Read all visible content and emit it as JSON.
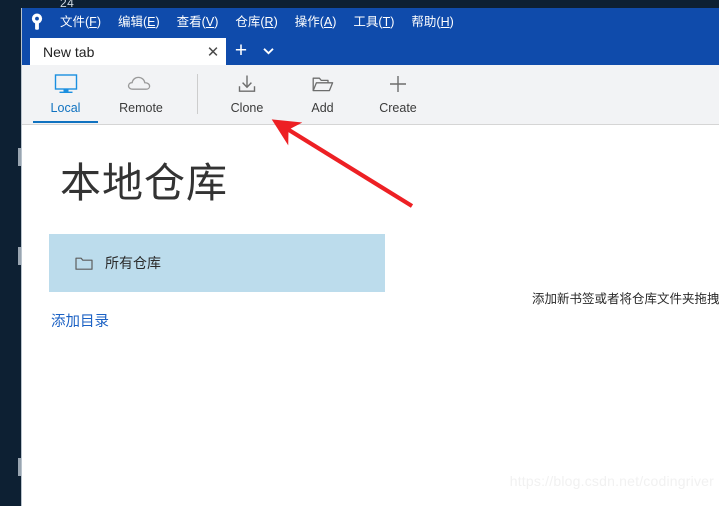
{
  "desktop": {
    "clipped_label": "24"
  },
  "titlebar": {
    "logo_icon": "sourcetree-key-icon",
    "menu": [
      {
        "label": "文件(F)",
        "text": "文件(",
        "mnemonic": "F",
        "tail": ")"
      },
      {
        "label": "编辑(E)",
        "text": "编辑(",
        "mnemonic": "E",
        "tail": ")"
      },
      {
        "label": "查看(V)",
        "text": "查看(",
        "mnemonic": "V",
        "tail": ")"
      },
      {
        "label": "仓库(R)",
        "text": "仓库(",
        "mnemonic": "R",
        "tail": ")"
      },
      {
        "label": "操作(A)",
        "text": "操作(",
        "mnemonic": "A",
        "tail": ")"
      },
      {
        "label": "工具(T)",
        "text": "工具(",
        "mnemonic": "T",
        "tail": ")"
      },
      {
        "label": "帮助(H)",
        "text": "帮助(",
        "mnemonic": "H",
        "tail": ")"
      }
    ]
  },
  "tabstrip": {
    "tab_title": "New tab",
    "close_glyph": "✕",
    "new_tab_glyph": "+",
    "dropdown_icon": "chevron-down-icon"
  },
  "toolbar": {
    "buttons": [
      {
        "label": "Local",
        "icon": "monitor-icon",
        "active": true
      },
      {
        "label": "Remote",
        "icon": "cloud-icon",
        "active": false
      },
      {
        "label": "Clone",
        "icon": "download-tray-icon",
        "active": false
      },
      {
        "label": "Add",
        "icon": "open-folder-icon",
        "active": false
      },
      {
        "label": "Create",
        "icon": "plus-icon",
        "active": false
      }
    ]
  },
  "content": {
    "page_title": "本地仓库",
    "repositories": [
      {
        "label": "所有仓库",
        "icon": "folder-icon"
      }
    ],
    "add_directory_link": "添加目录",
    "drop_hint": "添加新书签或者将仓库文件夹拖拽",
    "watermark": "https://blog.csdn.net/codingriver"
  },
  "annotation": {
    "arrow_color": "#ed2024",
    "points_at": "Clone"
  },
  "colors": {
    "titlebar_blue": "#0f4bab",
    "toolbar_bg": "#f2f3f5",
    "accent_blue": "#1072c0",
    "row_highlight": "#bcdcec",
    "link_blue": "#1b61c4",
    "desktop_navy": "#0d2033"
  }
}
